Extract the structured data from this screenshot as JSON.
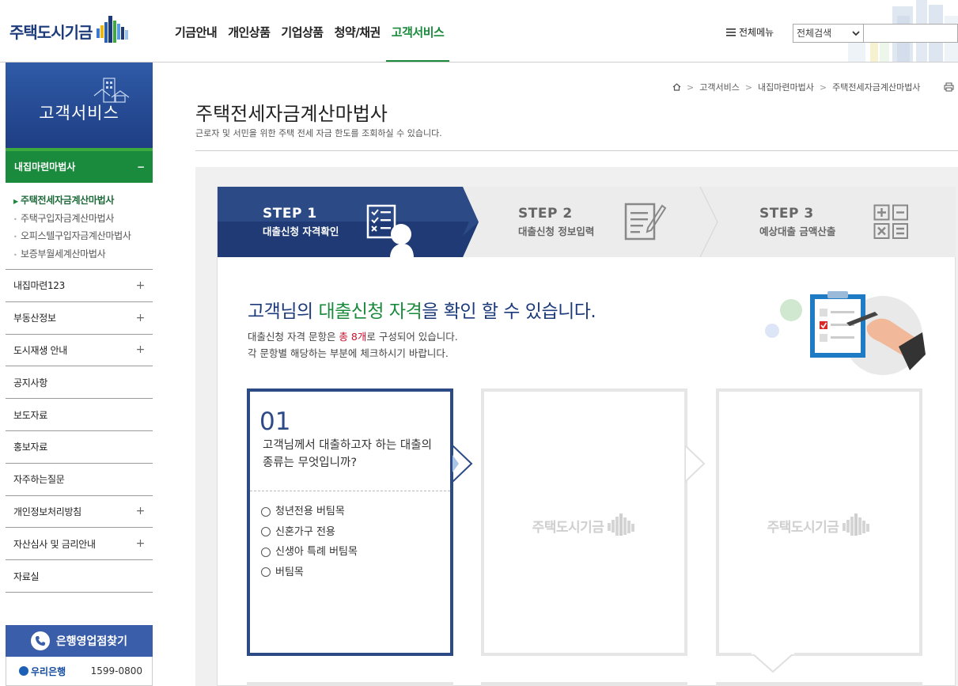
{
  "header": {
    "logo_text": "주택도시기금",
    "nav": [
      "기금안내",
      "개인상품",
      "기업상품",
      "청약/채권",
      "고객서비스"
    ],
    "nav_active_index": 4,
    "all_menu_label": "전체메뉴",
    "search_scope": "전체검색",
    "search_value": ""
  },
  "sidebar": {
    "title": "고객서비스",
    "active_section": "내집마련마법사",
    "active_section_toggle": "−",
    "sub_items": [
      "주택전세자금계산마법사",
      "주택구입자금계산마법사",
      "오피스텔구입자금계산마법사",
      "보증부월세계산마법사"
    ],
    "sub_active_index": 0,
    "items": [
      {
        "label": "내집마련123",
        "toggle": "+"
      },
      {
        "label": "부동산정보",
        "toggle": "+"
      },
      {
        "label": "도시재생 안내",
        "toggle": "+"
      },
      {
        "label": "공지사항",
        "toggle": ""
      },
      {
        "label": "보도자료",
        "toggle": ""
      },
      {
        "label": "홍보자료",
        "toggle": ""
      },
      {
        "label": "자주하는질문",
        "toggle": ""
      },
      {
        "label": "개인정보처리방침",
        "toggle": "+"
      },
      {
        "label": "자산심사 및 금리안내",
        "toggle": "+"
      },
      {
        "label": "자료실",
        "toggle": ""
      }
    ],
    "bank_finder_label": "은행영업점찾기",
    "bank_name": "우리은행",
    "bank_phone": "1599-0800"
  },
  "breadcrumb": [
    "고객서비스",
    "내집마련마법사",
    "주택전세자금계산마법사"
  ],
  "page": {
    "title": "주택전세자금계산마법사",
    "description": "근로자 및 서민을 위한 주택 전세 자금 한도를 조회하실 수 있습니다."
  },
  "steps": [
    {
      "label": "STEP 1",
      "sub": "대출신청 자격확인",
      "active": true
    },
    {
      "label": "STEP 2",
      "sub": "대출신청 정보입력",
      "active": false
    },
    {
      "label": "STEP 3",
      "sub": "예상대출 금액산출",
      "active": false
    }
  ],
  "intro": {
    "headline_pre": "고객님의 ",
    "headline_green": "대출신청 자격",
    "headline_post": "을 확인 할 수 있습니다.",
    "sub1_pre": "대출신청 자격 문항은 ",
    "sub1_red": "총 8개",
    "sub1_post": "로 구성되어 있습니다.",
    "sub2": "각 문항별 해당하는 부분에 체크하시기 바랍니다."
  },
  "question": {
    "number": "01",
    "text": "고객님께서 대출하고자 하는 대출의 종류는 무엇입니까?",
    "options": [
      "청년전용 버팀목",
      "신혼가구 전용",
      "신생아 특례 버팀목",
      "버팀목"
    ]
  },
  "placeholder_logo_text": "주택도시기금",
  "colors": {
    "brand_navy": "#1d3a7a",
    "brand_green": "#1a8a3c",
    "step_active": "#2c4a86",
    "card_active_border": "#2c4a86"
  }
}
